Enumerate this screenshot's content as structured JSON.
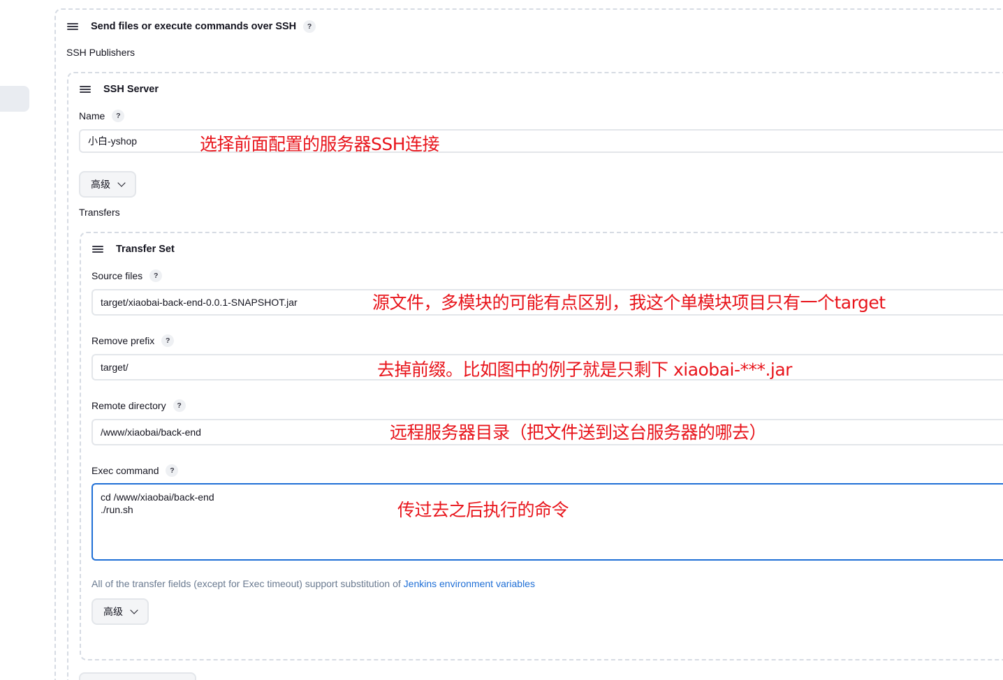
{
  "publisher_section": {
    "title": "Send files or execute commands over SSH",
    "help": "?",
    "subtitle": "SSH Publishers"
  },
  "ssh_server": {
    "title": "SSH Server",
    "name_label": "Name",
    "name_help": "?",
    "name_value": "小白-yshop",
    "advanced_label": "高级",
    "transfers_label": "Transfers"
  },
  "transfer_set": {
    "title": "Transfer Set",
    "source_files": {
      "label": "Source files",
      "help": "?",
      "value": "target/xiaobai-back-end-0.0.1-SNAPSHOT.jar"
    },
    "remove_prefix": {
      "label": "Remove prefix",
      "help": "?",
      "value": "target/"
    },
    "remote_directory": {
      "label": "Remote directory",
      "help": "?",
      "value": "/www/xiaobai/back-end"
    },
    "exec_command": {
      "label": "Exec command",
      "help": "?",
      "lines": [
        "cd /www/xiaobai/back-end",
        "./run.sh"
      ]
    },
    "hint_text": "All of the transfer fields (except for Exec timeout) support substitution of ",
    "hint_link": "Jenkins environment variables",
    "advanced_label": "高级"
  },
  "annotations": {
    "name": "选择前面配置的服务器SSH连接",
    "source_files": "源文件，多模块的可能有点区别，我这个单模块项目只有一个target",
    "remove_prefix": "去掉前缀。比如图中的例子就是只剩下 xiaobai-***.jar",
    "remote_directory": "远程服务器目录（把文件送到这台服务器的哪去）",
    "exec_command": "传过去之后执行的命令"
  },
  "colors": {
    "annotation": "#e8141b",
    "focus_border": "#1f6fd6",
    "link": "#1f6fd6"
  }
}
